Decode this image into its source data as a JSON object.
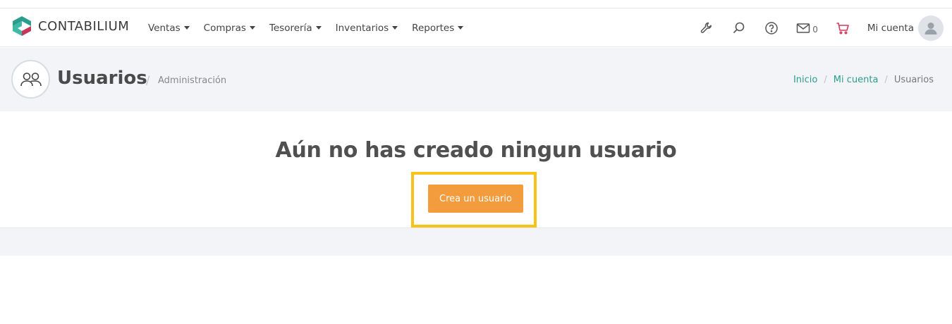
{
  "brand": {
    "name": "CONTABILIUM"
  },
  "nav": {
    "items": [
      {
        "label": "Ventas"
      },
      {
        "label": "Compras"
      },
      {
        "label": "Tesorería"
      },
      {
        "label": "Inventarios"
      },
      {
        "label": "Reportes"
      }
    ],
    "icons": [
      "wrench-icon",
      "search-icon",
      "help-icon",
      "mail-icon",
      "cart-icon"
    ],
    "mail_count": "0",
    "account_label": "Mi cuenta"
  },
  "header": {
    "title": "Usuarios",
    "separator": "/",
    "subtitle": "Administración",
    "breadcrumb": [
      {
        "label": "Inicio"
      },
      {
        "label": "Mi cuenta"
      },
      {
        "label": "Usuarios"
      }
    ]
  },
  "empty_state": {
    "message": "Aún no has creado ningun usuario",
    "button_label": "Crea un usuario"
  },
  "colors": {
    "brand_teal": "#2a9d8f",
    "brand_red": "#c4375a",
    "accent_orange": "#f29c3d",
    "highlight_yellow": "#f6c419",
    "cart_red": "#d23a5e"
  }
}
